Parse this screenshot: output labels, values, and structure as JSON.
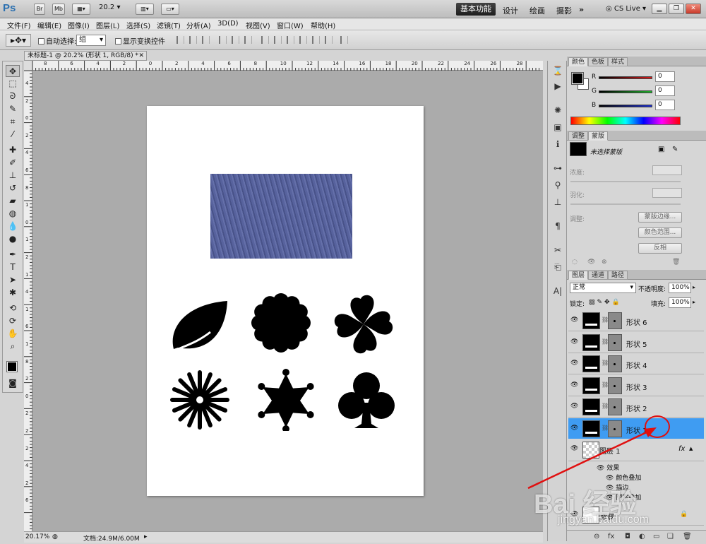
{
  "app": {
    "logo": "Ps",
    "zoom": "20.2",
    "workspace_active": "基本功能",
    "workspaces": [
      "设计",
      "绘画",
      "摄影"
    ],
    "more": "»",
    "cslive": "CS Live",
    "appbar_icons": [
      "Br",
      "Mb"
    ]
  },
  "menu": [
    "文件(F)",
    "编辑(E)",
    "图像(I)",
    "图层(L)",
    "选择(S)",
    "滤镜(T)",
    "分析(A)",
    "3D(D)",
    "视图(V)",
    "窗口(W)",
    "帮助(H)"
  ],
  "options": {
    "auto_select": "自动选择:",
    "auto_select_value": "组",
    "show_transform": "显示变换控件"
  },
  "document": {
    "tab_title": "未标题-1 @ 20.2% (形状 1, RGB/8) *",
    "ruler_h": [
      "8",
      "6",
      "4",
      "2",
      "0",
      "2",
      "4",
      "6",
      "8",
      "10",
      "12",
      "14",
      "16",
      "18",
      "20",
      "22",
      "24",
      "26",
      "28"
    ],
    "ruler_v": [
      "4",
      "2",
      "0",
      "2",
      "4",
      "6",
      "8",
      "1",
      "0",
      "1",
      "2",
      "1",
      "4",
      "1",
      "6",
      "1",
      "8",
      "2",
      "0",
      "2",
      "2",
      "2",
      "4",
      "2",
      "6"
    ]
  },
  "status": {
    "zoom": "20.17%",
    "doc": "文档:24.9M/6.00M"
  },
  "color_panel": {
    "tabs": [
      "颜色",
      "色板",
      "样式"
    ],
    "channels": [
      {
        "label": "R",
        "value": "0",
        "color": "#d61a1a"
      },
      {
        "label": "G",
        "value": "0",
        "color": "#1fae2b"
      },
      {
        "label": "B",
        "value": "0",
        "color": "#1d2fd1"
      }
    ]
  },
  "masks_panel": {
    "tabs": [
      "调整",
      "蒙版"
    ],
    "no_mask": "未选择蒙版",
    "density": "浓度:",
    "feather": "羽化:",
    "refine": "调整:",
    "btn_edge": "蒙版边缘...",
    "btn_color_range": "颜色范围...",
    "btn_invert": "反相"
  },
  "layers_panel": {
    "tabs": [
      "图层",
      "通道",
      "路径"
    ],
    "blend_mode": "正常",
    "opacity_label": "不透明度:",
    "opacity": "100%",
    "lock_label": "锁定:",
    "fill_label": "填充:",
    "fill": "100%",
    "layers": [
      {
        "name": "形状 6",
        "selected": false
      },
      {
        "name": "形状 5",
        "selected": false
      },
      {
        "name": "形状 4",
        "selected": false
      },
      {
        "name": "形状 3",
        "selected": false
      },
      {
        "name": "形状 2",
        "selected": false
      },
      {
        "name": "形状 1",
        "selected": true
      }
    ],
    "layer1_name": "图层 1",
    "fx": "fx",
    "effects_label": "效果",
    "effects": [
      "颜色叠加",
      "描边",
      "图案叠加"
    ],
    "background_name": "背景"
  },
  "watermark": "Bai 经验",
  "watermark_url": "jingyan.baidu.com"
}
